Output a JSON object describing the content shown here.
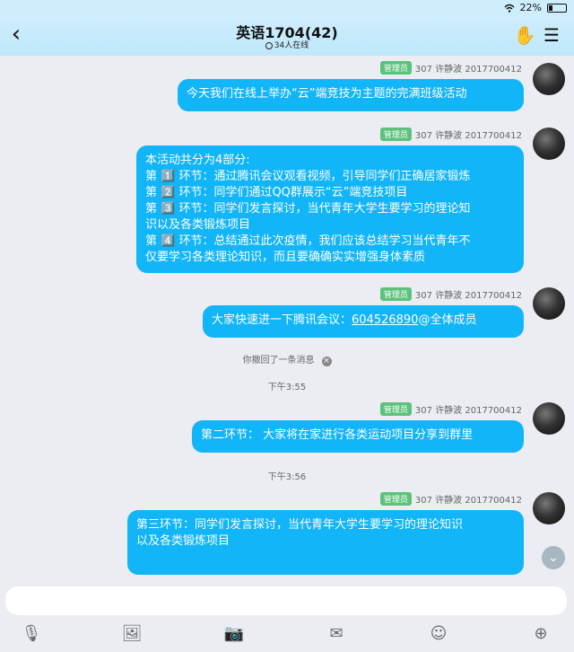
{
  "status": {
    "battery": "22%"
  },
  "header": {
    "title": "英语1704(42)",
    "online": "34人在线",
    "back_icon": "‹",
    "game_icon": "✋",
    "menu_icon": "☰"
  },
  "colors": {
    "accent": "#12b5f7",
    "badge": "#5cc27c"
  },
  "messages": [
    {
      "badge": "管理员",
      "sender": "307 许静波 2017700412",
      "lines": [
        "今天我们在线上举办“云”端竞技为主题的完满班级活动"
      ]
    },
    {
      "badge": "管理员",
      "sender": "307 许静波 2017700412",
      "lines": [
        "本活动共分为4部分:",
        "第 1️⃣ 环节：通过腾讯会议观看视频，引导同学们正确居家锻炼",
        "第 2️⃣ 环节：同学们通过QQ群展示“云”端竞技项目",
        "第 3️⃣ 环节：同学们发言探讨，当代青年大学生要学习的理论知",
        "识以及各类锻炼项目",
        "第 4️⃣ 环节：总结通过此次疫情，我们应该总结学习当代青年不",
        "仅要学习各类理论知识，而且要确确实实增强身体素质"
      ]
    },
    {
      "badge": "管理员",
      "sender": "307 许静波 2017700412",
      "prefix": "大家快速进一下腾讯会议：",
      "link": "604526890",
      "suffix": "@全体成员"
    },
    {
      "badge": "管理员",
      "sender": "307 许静波 2017700412",
      "lines": [
        "第二环节： 大家将在家进行各类运动项目分享到群里"
      ]
    },
    {
      "badge": "管理员",
      "sender": "307 许静波 2017700412",
      "lines": [
        "第三环节：同学们发言探讨，当代青年大学生要学习的理论知识",
        "以及各类锻炼项目"
      ]
    }
  ],
  "system": {
    "recalled": "你撤回了一条消息",
    "recalled_close": "×",
    "time1": "下午3:55",
    "time2": "下午3:56"
  },
  "toolbar": {
    "icons": [
      "microphone-icon",
      "image-icon",
      "camera-icon",
      "red-packet-icon",
      "emoji-icon",
      "plus-icon"
    ],
    "glyphs": [
      "🎙",
      "🖼",
      "📷",
      "✉",
      "☺",
      "⊕"
    ]
  },
  "scroll_icon": "⌄"
}
